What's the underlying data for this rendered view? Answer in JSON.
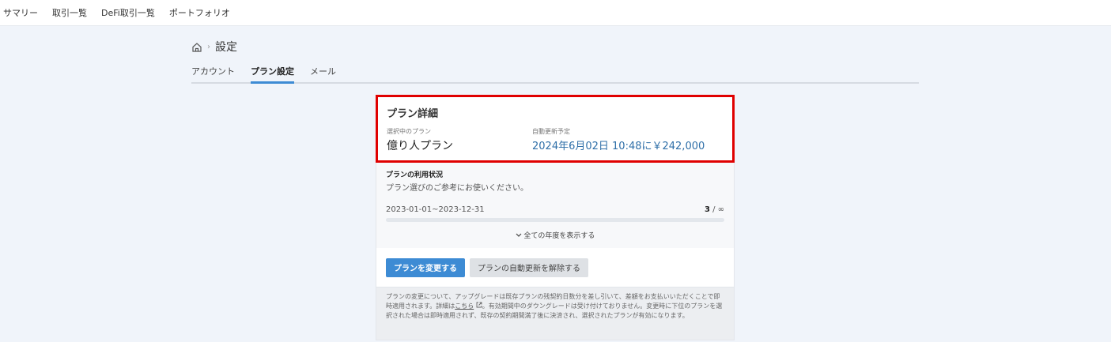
{
  "nav": {
    "items": [
      "サマリー",
      "取引一覧",
      "DeFi取引一覧",
      "ポートフォリオ"
    ]
  },
  "breadcrumb": {
    "sep": "›",
    "title": "設定",
    "icon": "home-icon"
  },
  "tabs": [
    {
      "label": "アカウント",
      "active": false
    },
    {
      "label": "プラン設定",
      "active": true
    },
    {
      "label": "メール",
      "active": false
    }
  ],
  "plan_detail": {
    "title": "プラン詳細",
    "current_label": "選択中のプラン",
    "current_value": "億り人プラン",
    "renewal_label": "自動更新予定",
    "renewal_value": "2024年6月02日 10:48に￥242,000",
    "highlight_color": "#e00000"
  },
  "usage": {
    "title": "プランの利用状況",
    "subtitle": "プラン選びのご参考にお使いください。",
    "period": "2023-01-01~2023-12-31",
    "used": "3",
    "limit": " / ∞",
    "fill_fraction": 0,
    "show_all": "全ての年度を表示する"
  },
  "actions": {
    "change_plan": "プランを変更する",
    "cancel_renewal": "プランの自動更新を解除する",
    "accent": "#3d8bd4"
  },
  "notice": {
    "text_1": "プランの変更について、アップグレードは既存プランの残契約日数分を差し引いて、差額をお支払いいただくことで即時適用されます。詳細は",
    "link": "こちら",
    "text_2": "。有効期間中のダウングレードは受け付けておりません。変更時に下位のプランを選択された場合は即時適用されず、既存の契約期間満了後に決済され、選択されたプランが有効になります。"
  }
}
